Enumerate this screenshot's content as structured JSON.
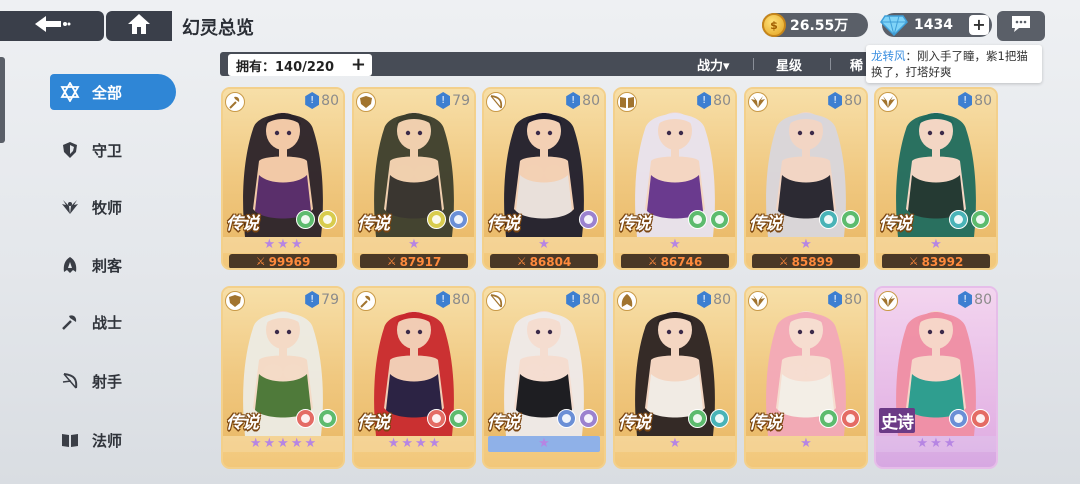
{
  "header": {
    "title": "幻灵总览",
    "gold": "26.55万",
    "gems": "1434"
  },
  "filter": {
    "owned_label": "拥有：140/220",
    "options": [
      "战力▾",
      "星级",
      "稀"
    ]
  },
  "chat_popup": {
    "user": "龙转风",
    "message": "：刚入手了瞳，紫1把猫换了，打塔好爽"
  },
  "sidebar": {
    "items": [
      {
        "label": "全部",
        "icon": "star-of-david-icon",
        "active": true
      },
      {
        "label": "守卫",
        "icon": "shield-icon",
        "active": false
      },
      {
        "label": "牧师",
        "icon": "wings-icon",
        "active": false
      },
      {
        "label": "刺客",
        "icon": "blade-icon",
        "active": false
      },
      {
        "label": "战士",
        "icon": "axe-icon",
        "active": false
      },
      {
        "label": "射手",
        "icon": "bow-icon",
        "active": false
      },
      {
        "label": "法师",
        "icon": "book-icon",
        "active": false
      }
    ]
  },
  "cards": [
    {
      "level": "80",
      "rarity": "传说",
      "class_icon": "axe-icon",
      "stars": 3,
      "power": "99969",
      "elements": [
        "grass",
        "light"
      ],
      "hair": "#2a2229",
      "skin": "#f2c9a7",
      "outfit": "#5a2f6b"
    },
    {
      "level": "79",
      "rarity": "传说",
      "class_icon": "shield-icon",
      "stars": 1,
      "power": "87917",
      "elements": [
        "light",
        "spirit"
      ],
      "hair": "#3b3d2c",
      "skin": "#f0cfae",
      "outfit": "#3a3630"
    },
    {
      "level": "80",
      "rarity": "传说",
      "class_icon": "bow-icon",
      "stars": 1,
      "power": "86804",
      "elements": [
        "void"
      ],
      "hair": "#1f1d2c",
      "skin": "#f3d0b4",
      "outfit": "#e9e0da"
    },
    {
      "level": "80",
      "rarity": "传说",
      "class_icon": "book-icon",
      "stars": 1,
      "power": "86746",
      "elements": [
        "grass",
        "grass"
      ],
      "hair": "#e8e3ef",
      "skin": "#f4d6c2",
      "outfit": "#6a3a8e"
    },
    {
      "level": "80",
      "rarity": "传说",
      "class_icon": "wings-icon",
      "stars": 1,
      "power": "85899",
      "elements": [
        "water",
        "grass"
      ],
      "hair": "#d8d6dc",
      "skin": "#f2d5c4",
      "outfit": "#2c2a33"
    },
    {
      "level": "80",
      "rarity": "传说",
      "class_icon": "wings-icon",
      "stars": 1,
      "power": "83992",
      "elements": [
        "water",
        "grass"
      ],
      "hair": "#1f6b5e",
      "skin": "#f3d6c4",
      "outfit": "#253a33"
    },
    {
      "level": "79",
      "rarity": "传说",
      "class_icon": "shield-icon",
      "stars": 5,
      "power": "",
      "elements": [
        "fire",
        "grass"
      ],
      "hair": "#ecebe4",
      "skin": "#f4dac6",
      "outfit": "#4f7a3a"
    },
    {
      "level": "80",
      "rarity": "传说",
      "class_icon": "axe-icon",
      "stars": 4,
      "power": "",
      "elements": [
        "fire",
        "grass"
      ],
      "hair": "#c8282d",
      "skin": "#f1ccb4",
      "outfit": "#2c2344"
    },
    {
      "level": "80",
      "rarity": "传说",
      "class_icon": "bow-icon",
      "stars": 1,
      "power": "",
      "elements": [
        "spirit",
        "void"
      ],
      "hair": "#eeeaea",
      "skin": "#f5ddd0",
      "outfit": "#1e1e22",
      "stars_blue": true
    },
    {
      "level": "80",
      "rarity": "传说",
      "class_icon": "blade-icon",
      "stars": 1,
      "power": "",
      "elements": [
        "grass",
        "water"
      ],
      "hair": "#2a2222",
      "skin": "#f4d6c2",
      "outfit": "#f1ebe4"
    },
    {
      "level": "80",
      "rarity": "传说",
      "class_icon": "wings-icon",
      "stars": 1,
      "power": "",
      "elements": [
        "grass",
        "fire"
      ],
      "hair": "#f2a9b8",
      "skin": "#f6ddd0",
      "outfit": "#f3eee6"
    },
    {
      "level": "80",
      "rarity": "史诗",
      "class_icon": "wings-icon",
      "stars": 3,
      "power": "",
      "elements": [
        "spirit",
        "fire"
      ],
      "hair": "#ef8ea3",
      "skin": "#f6d5c8",
      "outfit": "#2f9e8f",
      "epic": true
    }
  ]
}
